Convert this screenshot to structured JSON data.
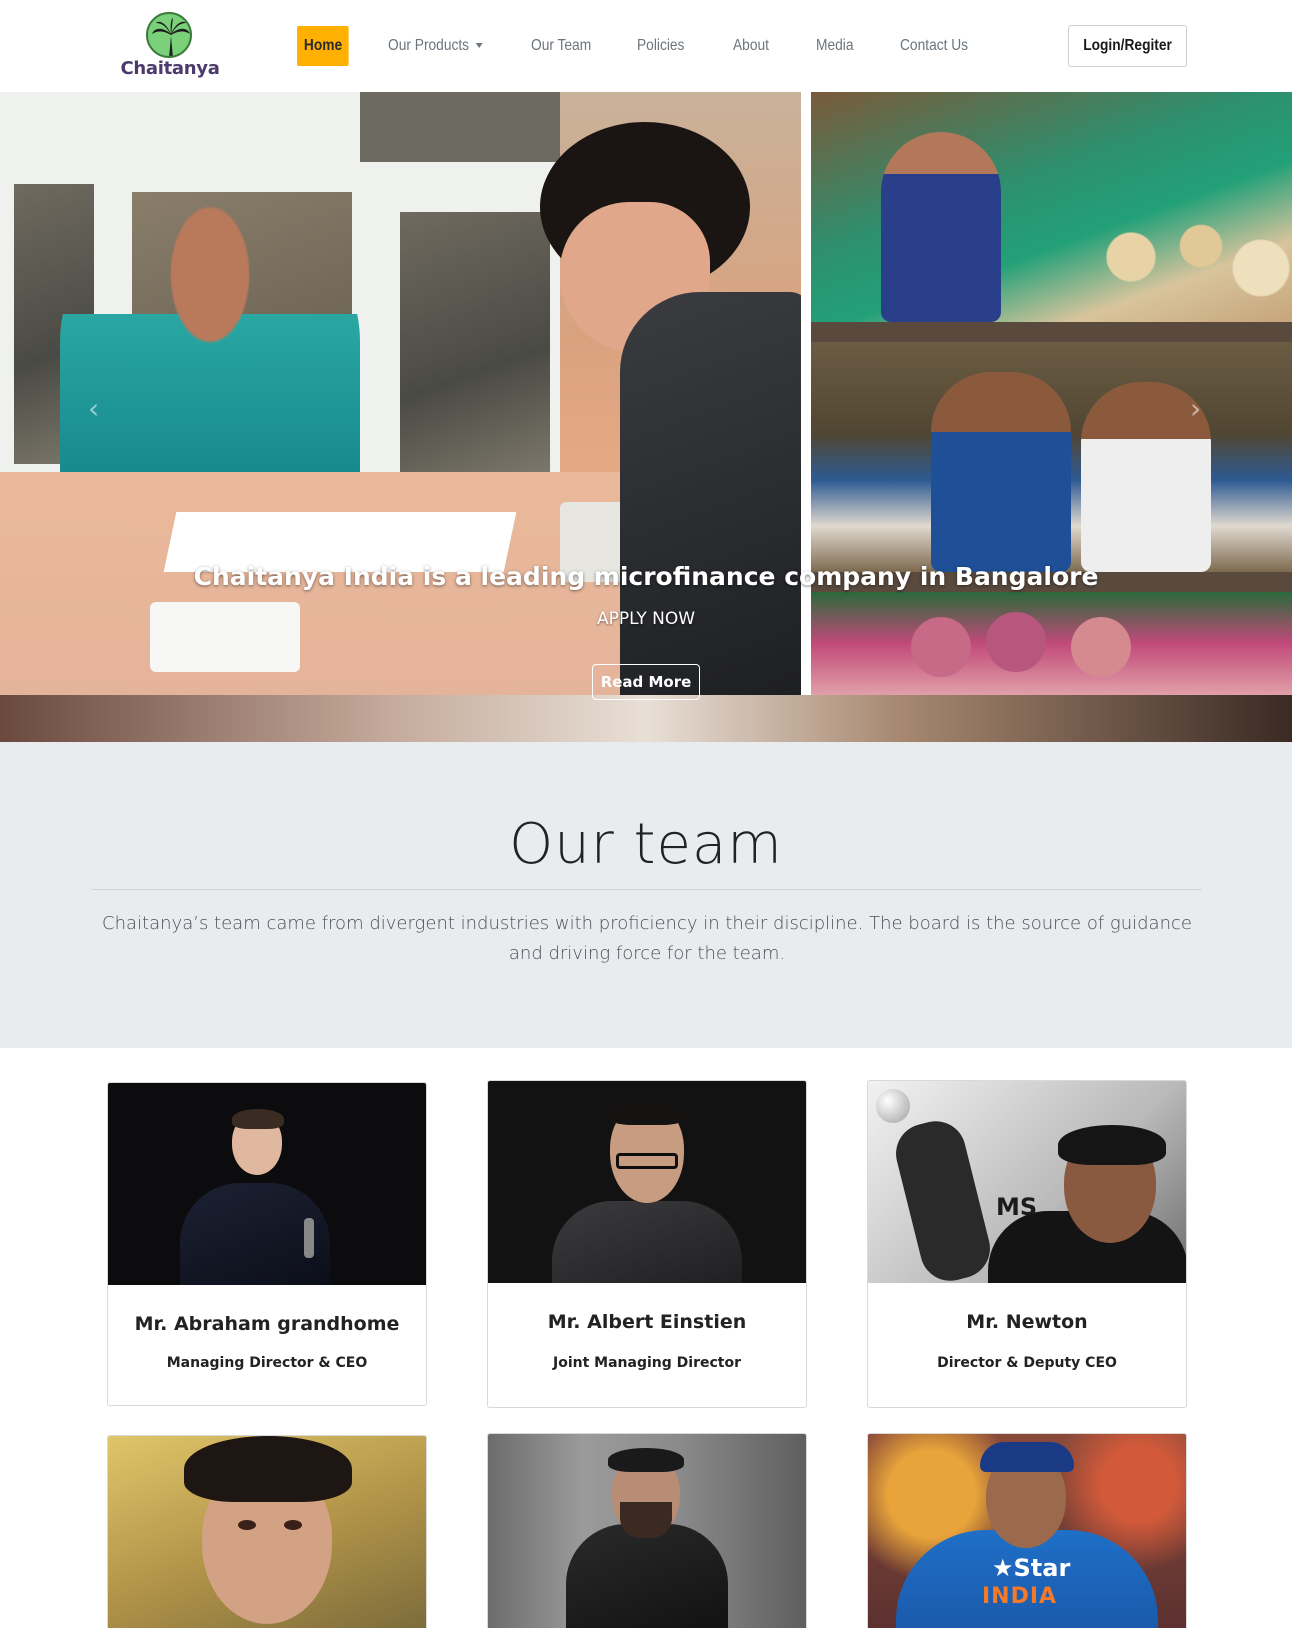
{
  "brand": {
    "name": "Chaitanya",
    "logo_icon": "palm-tree-icon",
    "accent_color": "#ffb000"
  },
  "nav": {
    "items": [
      {
        "label": "Home",
        "active": true
      },
      {
        "label": "Our Products",
        "dropdown": true
      },
      {
        "label": "Our Team"
      },
      {
        "label": "Policies"
      },
      {
        "label": "About"
      },
      {
        "label": "Media"
      },
      {
        "label": "Contact Us"
      }
    ],
    "login_label": "Login/Regiter"
  },
  "hero": {
    "title": "Chaitanya India is a leading microfinance company in Bangalore",
    "subtitle": "APPLY NOW",
    "button_label": "Read More",
    "prev_icon": "chevron-left-icon",
    "next_icon": "chevron-right-icon"
  },
  "team_section": {
    "title": "Our team",
    "description": "Chaitanya’s team came from divergent industries with proficiency in their discipline. The board is the source of guidance and driving force for the team."
  },
  "team": [
    {
      "name": "Mr. Abraham grandhome",
      "role": "Managing Director & CEO"
    },
    {
      "name": "Mr. Albert Einstien",
      "role": "Joint Managing Director"
    },
    {
      "name": "Mr. Newton",
      "role": "Director & Deputy CEO"
    },
    {
      "name": "",
      "role": ""
    },
    {
      "name": "",
      "role": ""
    },
    {
      "name": "",
      "role": ""
    }
  ],
  "photo_texts": {
    "ms_logo": "MS",
    "jersey_brand": "Star",
    "jersey_team": "INDIA"
  }
}
